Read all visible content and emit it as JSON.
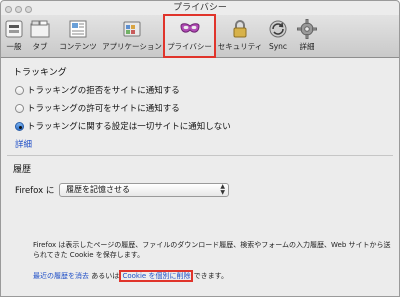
{
  "window": {
    "title": "プライバシー"
  },
  "toolbar": {
    "items": [
      {
        "label": "一般",
        "icon": "general-switch-icon"
      },
      {
        "label": "タブ",
        "icon": "tabs-icon"
      },
      {
        "label": "コンテンツ",
        "icon": "content-icon"
      },
      {
        "label": "アプリケーション",
        "icon": "applications-icon"
      },
      {
        "label": "プライバシー",
        "icon": "privacy-mask-icon",
        "selected": true
      },
      {
        "label": "セキュリティ",
        "icon": "security-lock-icon"
      },
      {
        "label": "Sync",
        "icon": "sync-icon"
      },
      {
        "label": "詳細",
        "icon": "gear-icon"
      }
    ]
  },
  "tracking": {
    "heading": "トラッキング",
    "options": [
      {
        "label": "トラッキングの拒否をサイトに通知する",
        "selected": false
      },
      {
        "label": "トラッキングの許可をサイトに通知する",
        "selected": false
      },
      {
        "label": "トラッキングに関する設定は一切サイトに通知しない",
        "selected": true
      }
    ],
    "details_link": "詳細"
  },
  "history": {
    "heading": "履歴",
    "firefox_label": "Firefox に",
    "select_value": "履歴を記憶させる",
    "description": "Firefox は表示したページの履歴、ファイルのダウンロード履歴、検索やフォームの入力履歴、Web サイトから送られてきた Cookie を保存します。",
    "clear_recent_link": "最近の履歴を消去",
    "connector": "あるいは",
    "remove_cookies_link": "Cookie を個別に削除",
    "suffix": "できます。"
  },
  "colors": {
    "highlight_box": "#e0342b",
    "link": "#1f4fc7",
    "radio_selected": "#2f6fc9"
  }
}
